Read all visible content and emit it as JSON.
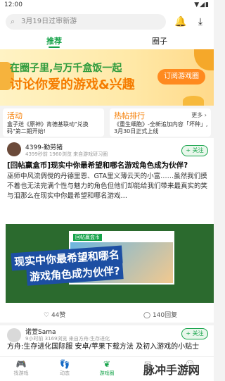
{
  "status_bar": {
    "time": "12:00",
    "icons": "▼◢▮"
  },
  "search": {
    "placeholder": "3月19日过审新游"
  },
  "header_icons": {
    "notifications": "bell-icon",
    "downloads": "download-icon"
  },
  "tabs": [
    {
      "label": "推荐",
      "active": true
    },
    {
      "label": "圈子",
      "active": false
    }
  ],
  "banner": {
    "line1": "在圈子里,与万千盒饭一起",
    "line2": "讨论你爱的游戏&兴趣",
    "cta": "订阅游戏圈"
  },
  "activity_card": {
    "title": "活动",
    "text": "盒子送《原神》肯德基联动\"兑换码\"第二期开始!"
  },
  "hot_card": {
    "title": "热帖排行",
    "more": "更多 ›",
    "text": "《重生细胞》-全新追加内容「坏种」, 3月30日正式上线"
  },
  "post1": {
    "author": "4399-勤劳猪",
    "meta": "4399秒前 1960浏览 来自游戏研习圈",
    "follow": "+ 关注",
    "title": "[回帖赢盒币]现实中你最希望和哪名游戏角色成为伙伴?",
    "body": "巫师中风流倜傥的丹德里恩、GTA里义薄云天的小富……虽然我们摸不着也无法完满个性与魅力的角色但他们却能给我们带来最真实的笑与泪那么在现实中你最希望和哪名游戏…",
    "image_label": "回帖赢盒币",
    "image_head1": "现实中你最希望和哪名",
    "image_head2": "游戏角色成为伙伴?",
    "likes": "44赞",
    "comments": "140回复"
  },
  "post2": {
    "author": "诺萱Sama",
    "meta": "9小时前 3169浏览 来自方舟:生存进化",
    "follow": "+ 关注",
    "title": "方舟:生存进化国际服 安卓/苹果下载方法 及初入游戏的小贴士"
  },
  "bottom_nav": [
    {
      "label": "找游戏",
      "icon": "gamepad-icon",
      "active": false
    },
    {
      "label": "动态",
      "icon": "footprint-icon",
      "active": false
    },
    {
      "label": "游戏圈",
      "icon": "leaf-icon",
      "active": true
    },
    {
      "label": "消息",
      "icon": "message-icon",
      "active": false
    },
    {
      "label": "我",
      "icon": "user-icon",
      "active": false
    }
  ],
  "watermark": "脉冲手游网"
}
